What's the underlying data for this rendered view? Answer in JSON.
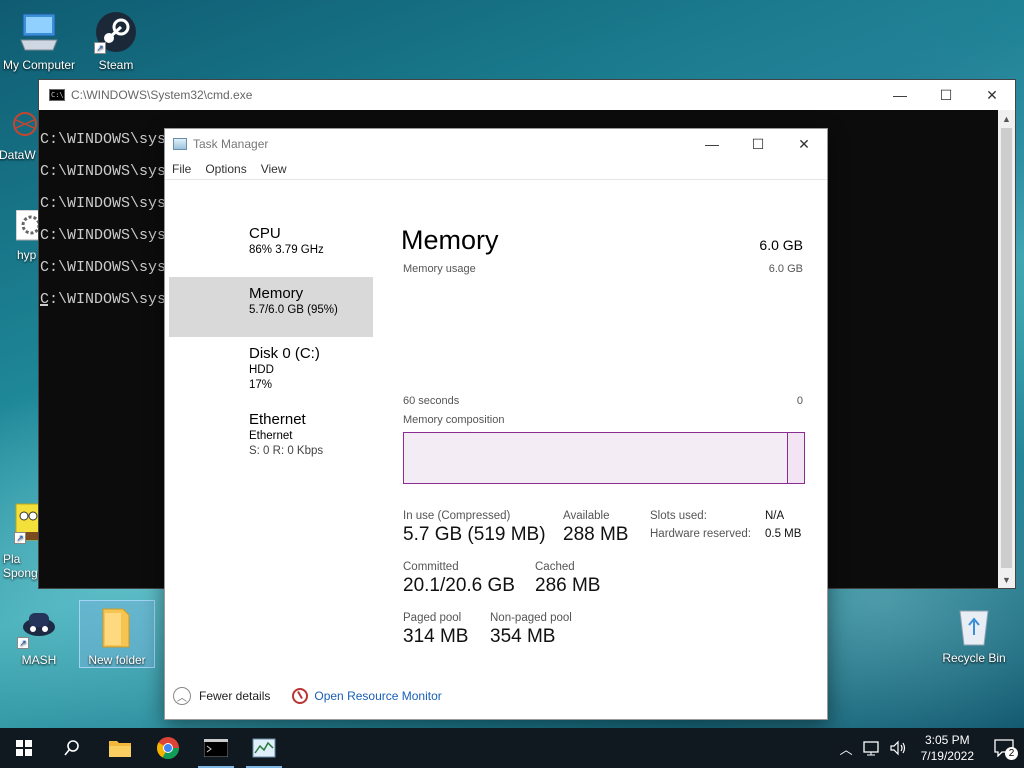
{
  "desktop": {
    "icons": [
      {
        "label": "My Computer"
      },
      {
        "label": "Steam"
      },
      {
        "label": "DataW"
      },
      {
        "label": "hyp"
      },
      {
        "label": "Pla Sponge"
      },
      {
        "label": "MASH"
      },
      {
        "label": "New folder"
      },
      {
        "label": "Recycle Bin"
      }
    ]
  },
  "cmd": {
    "title": "C:\\WINDOWS\\System32\\cmd.exe",
    "lines": [
      "C:\\WINDOWS\\syste",
      "C:\\WINDOWS\\syste",
      "C:\\WINDOWS\\syste",
      "C:\\WINDOWS\\syste",
      "C:\\WINDOWS\\syste",
      "C:\\WINDOWS\\syste"
    ]
  },
  "taskmanager": {
    "title": "Task Manager",
    "menu": [
      "File",
      "Options",
      "View"
    ],
    "sidebar": [
      {
        "title": "CPU",
        "sub1": "86%  3.79 GHz",
        "sub2": "",
        "sub3": ""
      },
      {
        "title": "Memory",
        "sub1": "5.7/6.0 GB (95%)",
        "sub2": "",
        "sub3": ""
      },
      {
        "title": "Disk 0 (C:)",
        "sub1": "HDD",
        "sub2": "17%",
        "sub3": ""
      },
      {
        "title": "Ethernet",
        "sub1": "Ethernet",
        "sub2": "S: 0  R: 0 Kbps",
        "sub3": ""
      }
    ],
    "heading": "Memory",
    "total": "6.0 GB",
    "usage_label": "Memory usage",
    "usage_max": "6.0 GB",
    "time_left": "60 seconds",
    "time_right": "0",
    "composition_label": "Memory composition",
    "stats": {
      "in_use_label": "In use (Compressed)",
      "in_use": "5.7 GB (519 MB)",
      "available_label": "Available",
      "available": "288 MB",
      "committed_label": "Committed",
      "committed": "20.1/20.6 GB",
      "cached_label": "Cached",
      "cached": "286 MB",
      "paged_label": "Paged pool",
      "paged": "314 MB",
      "nonpaged_label": "Non-paged pool",
      "nonpaged": "354 MB"
    },
    "details": {
      "slots_label": "Slots used:",
      "slots": "N/A",
      "hw_label": "Hardware reserved:",
      "hw": "0.5 MB"
    },
    "fewer_details": "Fewer details",
    "open_rm": "Open Resource Monitor"
  },
  "taskbar": {
    "time": "3:05 PM",
    "date": "7/19/2022",
    "notifications": "2"
  }
}
